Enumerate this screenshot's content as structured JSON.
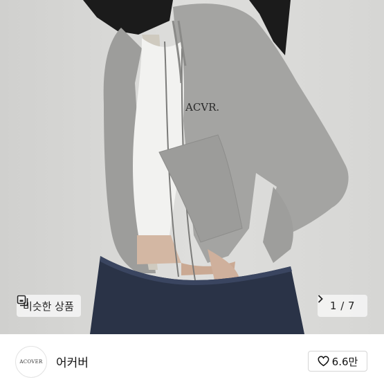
{
  "photo": {
    "description_icon": "product-photo",
    "logo_text": "ACVR."
  },
  "similar": {
    "label": "비슷한 상품",
    "icon": "similar-items-icon"
  },
  "pager": {
    "text": "1 / 7",
    "icon": "chevron-right-icon"
  },
  "seller": {
    "avatar_text": "ACOVER",
    "name": "어커버"
  },
  "like": {
    "count": "6.6만",
    "icon": "heart-icon"
  },
  "colors": {
    "background": "#ffffff",
    "photo_bg": "#d9d9d7",
    "hoodie": "#a3a3a1",
    "denim": "#2b3448",
    "chip_bg": "#f5f5f5"
  }
}
